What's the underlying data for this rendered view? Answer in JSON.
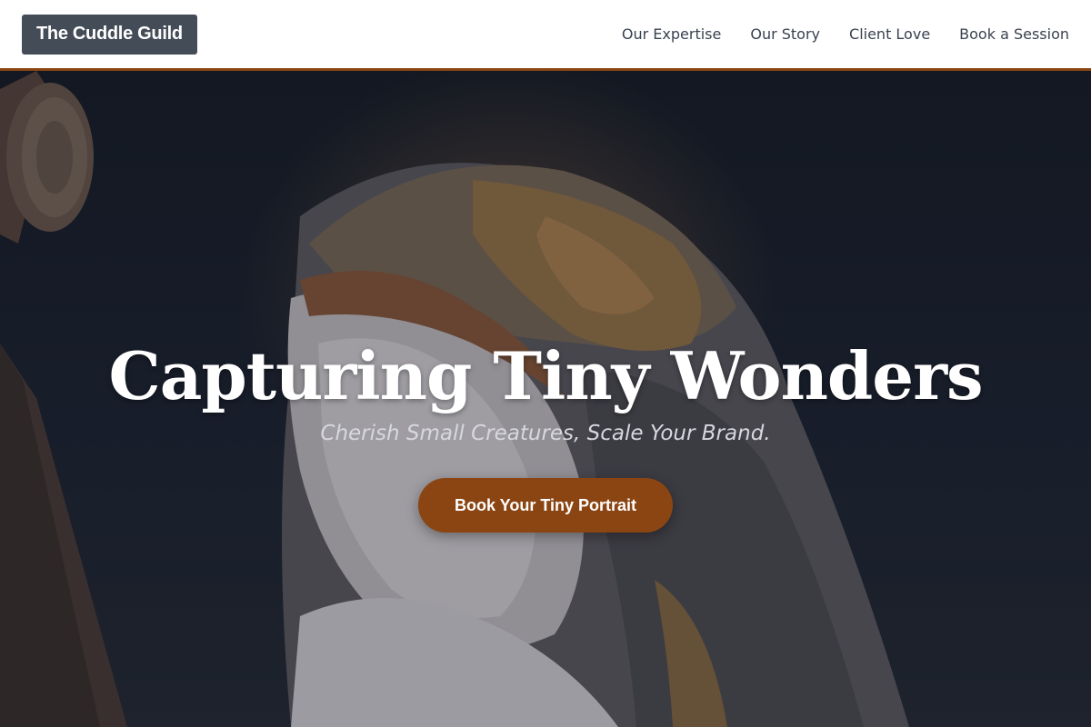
{
  "header": {
    "logo": "The Cuddle Guild",
    "nav": [
      {
        "label": "Our Expertise"
      },
      {
        "label": "Our Story"
      },
      {
        "label": "Client Love"
      },
      {
        "label": "Book a Session"
      }
    ]
  },
  "hero": {
    "title": "Capturing Tiny Wonders",
    "tagline": "Cherish Small Creatures, Scale Your Brand.",
    "cta_label": "Book Your Tiny Portrait",
    "background_subject": "barn owl photo"
  },
  "colors": {
    "accent": "#8b4513",
    "logo_bg": "#444c58",
    "nav_text": "#3a4250",
    "hero_dark": "#1b2230"
  }
}
